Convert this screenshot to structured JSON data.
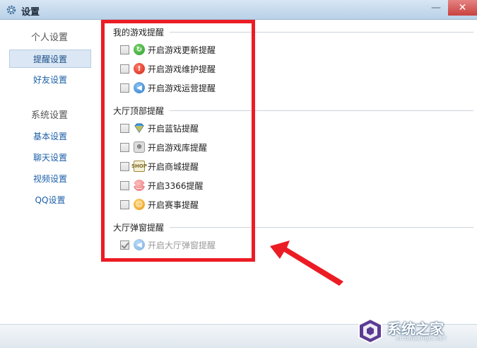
{
  "window": {
    "title": "设置"
  },
  "sidebar": {
    "group1": "个人设置",
    "items1": [
      {
        "label": "提醒设置",
        "active": true
      },
      {
        "label": "好友设置",
        "active": false
      }
    ],
    "group2": "系统设置",
    "items2": [
      {
        "label": "基本设置"
      },
      {
        "label": "聊天设置"
      },
      {
        "label": "视频设置"
      },
      {
        "label": "QQ设置"
      }
    ]
  },
  "sections": [
    {
      "title": "我的游戏提醒",
      "rows": [
        {
          "label": "开启游戏更新提醒",
          "icon": "update-icon",
          "checked": false
        },
        {
          "label": "开启游戏维护提醒",
          "icon": "warning-icon",
          "checked": false
        },
        {
          "label": "开启游戏运营提醒",
          "icon": "speaker-icon",
          "checked": false
        }
      ]
    },
    {
      "title": "大厅顶部提醒",
      "rows": [
        {
          "label": "开启蓝钻提醒",
          "icon": "blue-diamond-icon",
          "checked": false
        },
        {
          "label": "开启游戏库提醒",
          "icon": "gamepad-icon",
          "checked": false
        },
        {
          "label": "开启商城提醒",
          "icon": "shop-icon",
          "checked": false
        },
        {
          "label": "开启3366提醒",
          "icon": "pig-icon",
          "checked": false
        },
        {
          "label": "开启赛事提醒",
          "icon": "trophy-icon",
          "checked": false
        }
      ]
    },
    {
      "title": "大厅弹窗提醒",
      "rows": [
        {
          "label": "开启大厅弹窗提醒",
          "icon": "speaker-icon",
          "checked": true,
          "disabled": true
        }
      ]
    }
  ],
  "watermark": {
    "text": "系统之家",
    "url": "XITONGZHIJIA.NET"
  },
  "colors": {
    "highlight": "#ec1c24",
    "accent": "#1b5fa8"
  }
}
